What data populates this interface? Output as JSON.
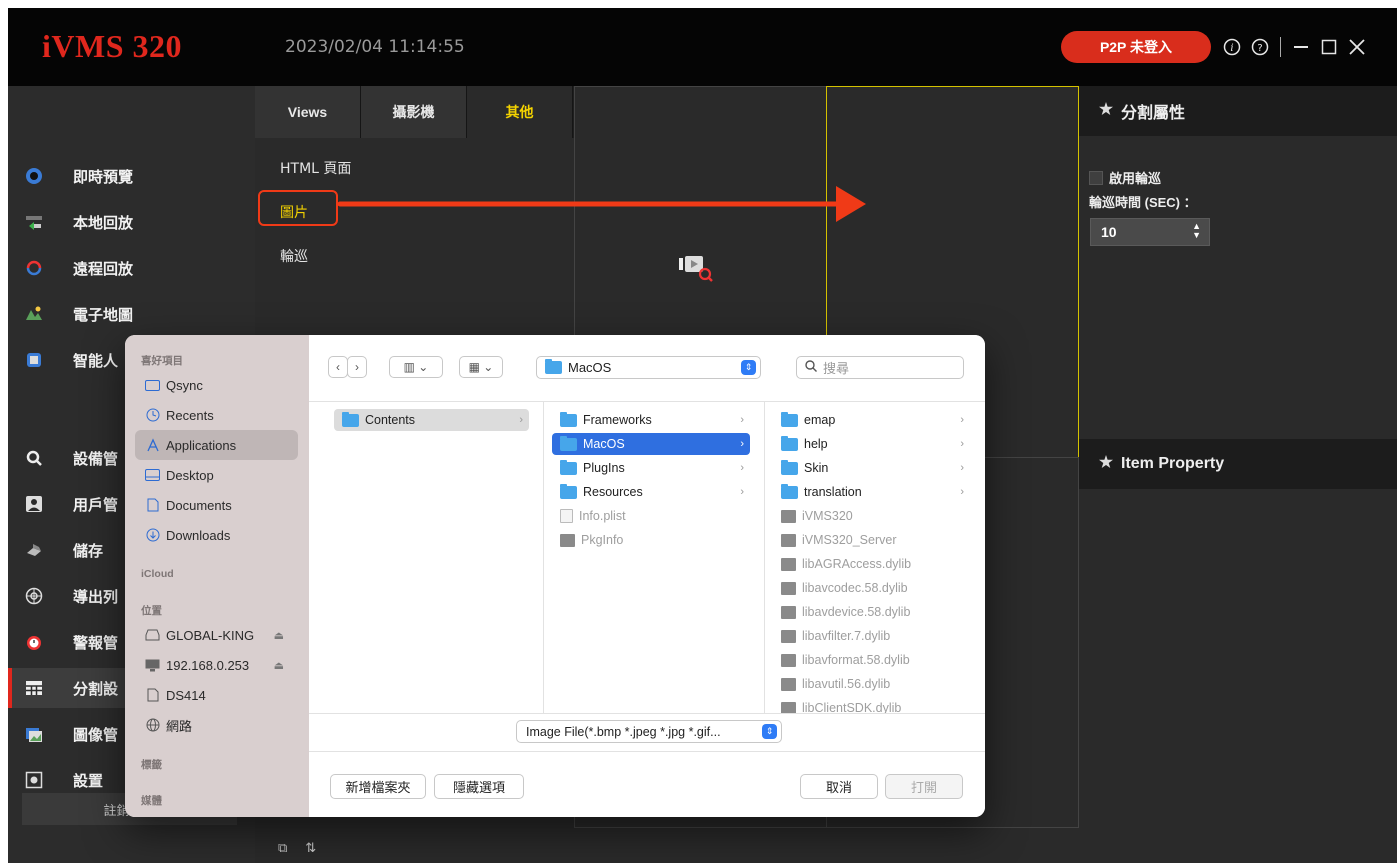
{
  "app": {
    "logo": "iVMS 320",
    "datetime": "2023/02/04 11:14:55",
    "p2p_label": "P2P 未登入",
    "accent_color": "#e0271d",
    "highlight_color": "#f3d200"
  },
  "titlebar_icons": [
    "info-icon",
    "help-icon",
    "minimize-icon",
    "maximize-icon",
    "close-icon"
  ],
  "nav": {
    "items": [
      {
        "label": "即時預覽",
        "icon": "live-view-icon"
      },
      {
        "label": "本地回放",
        "icon": "local-playback-icon"
      },
      {
        "label": "遠程回放",
        "icon": "remote-playback-icon"
      },
      {
        "label": "電子地圖",
        "icon": "emap-icon"
      },
      {
        "label": "智能人",
        "icon": "smart-icon"
      },
      {
        "label": "設備管",
        "icon": "device-icon"
      },
      {
        "label": "用戶管",
        "icon": "user-icon"
      },
      {
        "label": "儲存",
        "icon": "storage-icon"
      },
      {
        "label": "導出列",
        "icon": "export-icon"
      },
      {
        "label": "警報管",
        "icon": "alarm-icon"
      },
      {
        "label": "分割設",
        "icon": "split-icon"
      },
      {
        "label": "圖像管",
        "icon": "image-icon"
      },
      {
        "label": "設置",
        "icon": "settings-icon"
      }
    ],
    "logout_label": "註銷用戶"
  },
  "tabs": [
    "Views",
    "攝影機",
    "其他"
  ],
  "panel_list": [
    "HTML 頁面",
    "圖片",
    "輪巡"
  ],
  "right_panel": {
    "split_header": "分割屬性",
    "enable_tour": "啟用輪巡",
    "tour_time_label": "輪巡時間 (SEC) ：",
    "tour_time_value": "10",
    "item_header": "Item Property"
  },
  "dialog": {
    "sidebar": {
      "favorites_title": "喜好項目",
      "favorites": [
        "Qsync",
        "Recents",
        "Applications",
        "Desktop",
        "Documents",
        "Downloads"
      ],
      "icloud_title": "iCloud",
      "locations_title": "位置",
      "locations": [
        "GLOBAL-KING",
        "192.168.0.253",
        "DS414",
        "網路"
      ],
      "tags_title": "標籤",
      "media_title": "媒體"
    },
    "path_popup": "MacOS",
    "search_placeholder": "搜尋",
    "columns": [
      [
        {
          "name": "Contents",
          "type": "folder"
        }
      ],
      [
        {
          "name": "Frameworks",
          "type": "folder"
        },
        {
          "name": "MacOS",
          "type": "folder"
        },
        {
          "name": "PlugIns",
          "type": "folder"
        },
        {
          "name": "Resources",
          "type": "folder"
        },
        {
          "name": "Info.plist",
          "type": "doc"
        },
        {
          "name": "PkgInfo",
          "type": "exe"
        }
      ],
      [
        {
          "name": "emap",
          "type": "folder"
        },
        {
          "name": "help",
          "type": "folder"
        },
        {
          "name": "Skin",
          "type": "folder"
        },
        {
          "name": "translation",
          "type": "folder"
        },
        {
          "name": "iVMS320",
          "type": "exe"
        },
        {
          "name": "iVMS320_Server",
          "type": "exe"
        },
        {
          "name": "libAGRAccess.dylib",
          "type": "exe"
        },
        {
          "name": "libavcodec.58.dylib",
          "type": "exe"
        },
        {
          "name": "libavdevice.58.dylib",
          "type": "exe"
        },
        {
          "name": "libavfilter.7.dylib",
          "type": "exe"
        },
        {
          "name": "libavformat.58.dylib",
          "type": "exe"
        },
        {
          "name": "libavutil.56.dylib",
          "type": "exe"
        },
        {
          "name": "libClientSDK.dylib",
          "type": "exe"
        }
      ]
    ],
    "file_filter": "Image File(*.bmp *.jpeg *.jpg *.gif...",
    "new_folder_label": "新增檔案夾",
    "hide_options_label": "隱藏選項",
    "cancel_label": "取消",
    "open_label": "打開"
  }
}
